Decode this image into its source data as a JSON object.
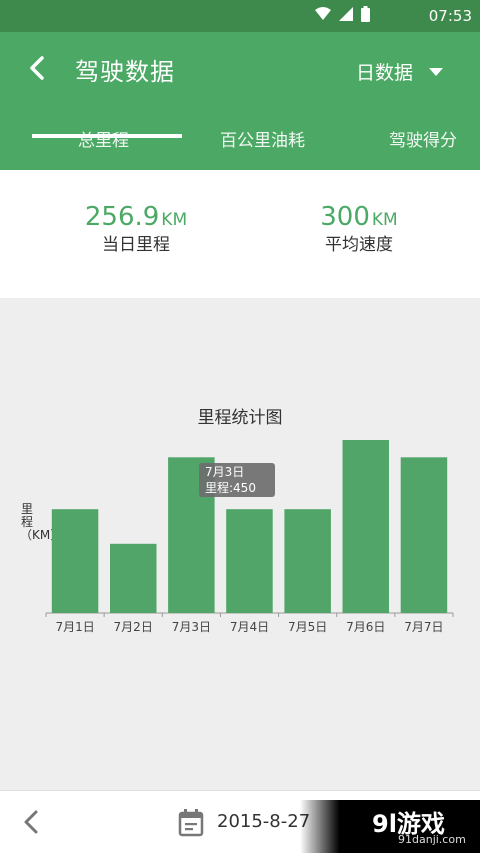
{
  "status_bar": {
    "time": "07:53"
  },
  "header": {
    "title": "驾驶数据",
    "mode_label": "日数据"
  },
  "tabs": [
    {
      "label": "总里程",
      "active": true
    },
    {
      "label": "百公里油耗",
      "active": false
    },
    {
      "label": "驾驶得分",
      "active": false
    }
  ],
  "summary": {
    "distance": {
      "value": "256.9",
      "unit": "KM",
      "label": "当日里程"
    },
    "speed": {
      "value": "300",
      "unit": "KM",
      "label": "平均速度"
    }
  },
  "chart_data": {
    "type": "bar",
    "title": "里程统计图",
    "ylabel": "里程（KM）",
    "categories": [
      "7月1日",
      "7月2日",
      "7月3日",
      "7月4日",
      "7月5日",
      "7月6日",
      "7月7日"
    ],
    "values": [
      300,
      200,
      450,
      300,
      300,
      500,
      450
    ],
    "ylim": [
      0,
      500
    ],
    "color": "#52a569",
    "tooltip": {
      "line1": "7月3日",
      "line2": "里程:450"
    }
  },
  "footer": {
    "date": "2015-8-27"
  },
  "watermark": {
    "logo": "9l游戏",
    "site": "91danji.com"
  }
}
